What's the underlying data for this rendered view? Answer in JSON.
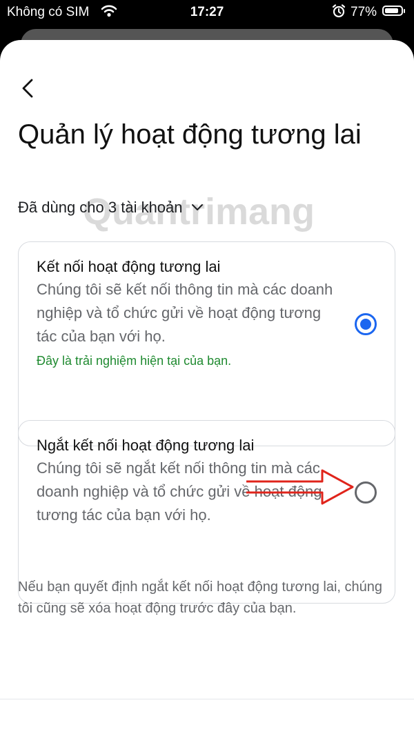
{
  "status": {
    "carrier": "Không có SIM",
    "time": "17:27",
    "battery": "77%",
    "battery_level": 0.77
  },
  "header": {
    "title": "Quản lý hoạt động tương lai",
    "accounts_label": "Đã dùng cho 3 tài khoản"
  },
  "options": [
    {
      "title": "Kết nối hoạt động tương lai",
      "description": "Chúng tôi sẽ kết nối thông tin mà các doanh nghiệp và tổ chức gửi về hoạt động tương tác của bạn với họ.",
      "note": "Đây là trải nghiệm hiện tại của bạn.",
      "selected": true
    },
    {
      "title": "Ngắt kết nối hoạt động tương lai",
      "description": "Chúng tôi sẽ ngắt kết nối thông tin mà các doanh nghiệp và tổ chức gửi về hoạt động tương tác của bạn với họ.",
      "selected": false
    }
  ],
  "footnote": "Nếu bạn quyết định ngắt kết nối hoạt động tương lai, chúng tôi cũng sẽ xóa hoạt động trước đây của bạn.",
  "watermark": "Quantrimang",
  "colors": {
    "accent": "#1b66f0",
    "note": "#1f8a30",
    "annotation_arrow": "#e0241b"
  }
}
